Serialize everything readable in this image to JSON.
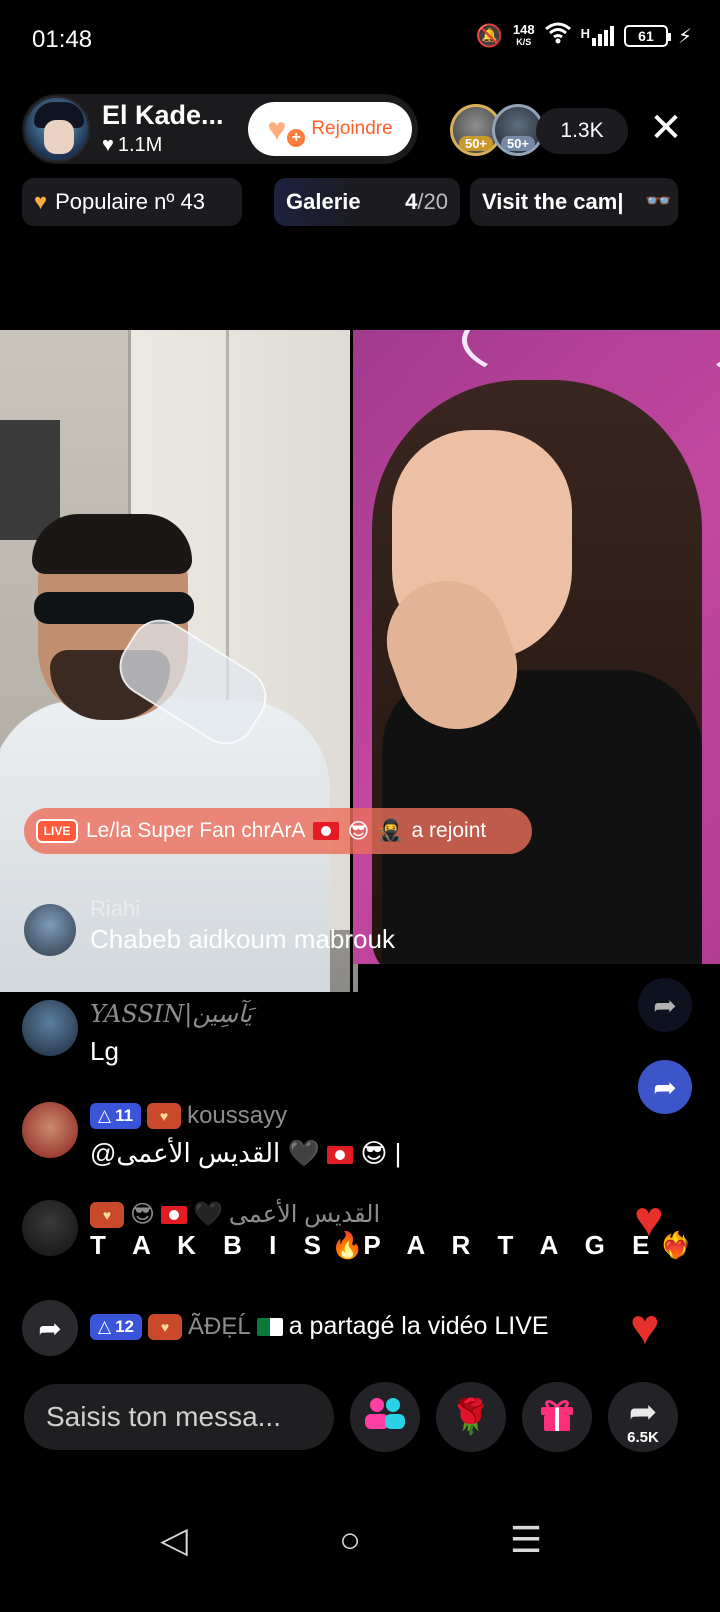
{
  "status_bar": {
    "time": "01:48",
    "net_speed": "148",
    "net_unit": "K/S",
    "signal_type": "H",
    "battery": "61"
  },
  "host": {
    "name": "El Kade...",
    "likes": "1.1M",
    "join_label": "Rejoindre"
  },
  "viewers": {
    "badge1": "50+",
    "badge2": "50+",
    "count": "1.3K"
  },
  "chips": {
    "popular": "Populaire nº 43",
    "gallery_label": "Galerie",
    "gallery_current": "4",
    "gallery_total": "/20",
    "visit": "Visit the cam|"
  },
  "join_banner": {
    "prefix": "Le/la Super Fan chrArA",
    "suffix": "a rejoint"
  },
  "overlay_comment": {
    "name": "Riahi",
    "text": "Chabeb aidkoum mabrouk"
  },
  "messages": [
    {
      "name": "YASSIN|يَآسِين",
      "text": "Lg"
    },
    {
      "level": "11",
      "name": "koussayy",
      "text": "@القديس الأعمى 🖤",
      "text_tail": "😎 |"
    },
    {
      "name": "القديس الأعمى",
      "text_a": "T A K B I S",
      "text_b": "P A R T A G E"
    },
    {
      "level": "12",
      "name": "ÃĐẸĹ",
      "text": "a partagé la vidéo LIVE"
    }
  ],
  "bottom_bar": {
    "placeholder": "Saisis ton messa...",
    "share_count": "6.5K"
  },
  "icons": {
    "close": "close-icon",
    "heart": "heart-icon",
    "share": "share-icon",
    "gift": "gift-icon",
    "rose": "rose-icon",
    "guests": "guests-icon",
    "back": "nav-back-icon",
    "home": "nav-home-icon",
    "menu": "nav-menu-icon"
  },
  "colors": {
    "accent_join": "#ff5f2a",
    "level_badge": "#3a55d9",
    "heart": "#e7302c",
    "takbis": "#44b6ea"
  }
}
